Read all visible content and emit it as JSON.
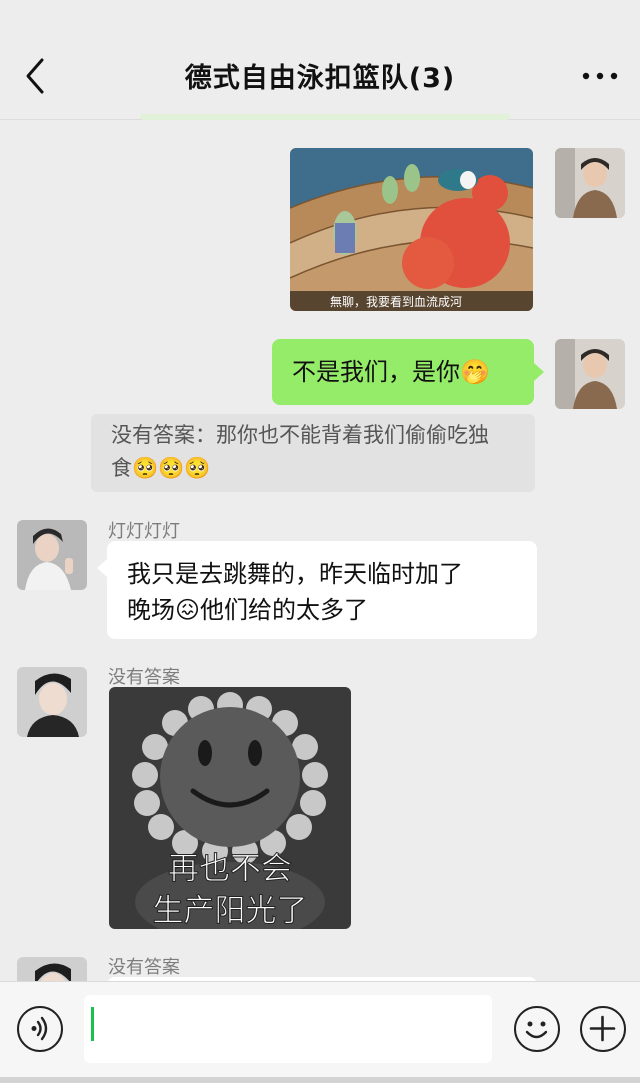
{
  "header": {
    "title": "德式自由泳扣篮队(3)"
  },
  "messages": {
    "m1": {
      "caption": "無聊，我要看到血流成河"
    },
    "m2": {
      "text": "不是我们，是你🤭"
    },
    "m2_quote": {
      "line1": "没有答案：那你也不能背着我们偷偷吃独",
      "line2": "食🥺🥺🥺"
    },
    "m3": {
      "sender": "灯灯灯灯",
      "line1": "我只是去跳舞的，昨天临时加了",
      "line2": "晚场😖他们给的太多了"
    },
    "m4": {
      "sender": "没有答案",
      "sticker_line1": "再也不会",
      "sticker_line2": "生产阳光了"
    },
    "m5": {
      "sender": "没有答案"
    }
  },
  "colors": {
    "background": "#ededed",
    "self_bubble": "#95ec69",
    "other_bubble": "#ffffff",
    "caret": "#19c24b"
  },
  "icons": [
    "back-icon",
    "more-icon",
    "voice-icon",
    "emoji-icon",
    "plus-icon"
  ]
}
